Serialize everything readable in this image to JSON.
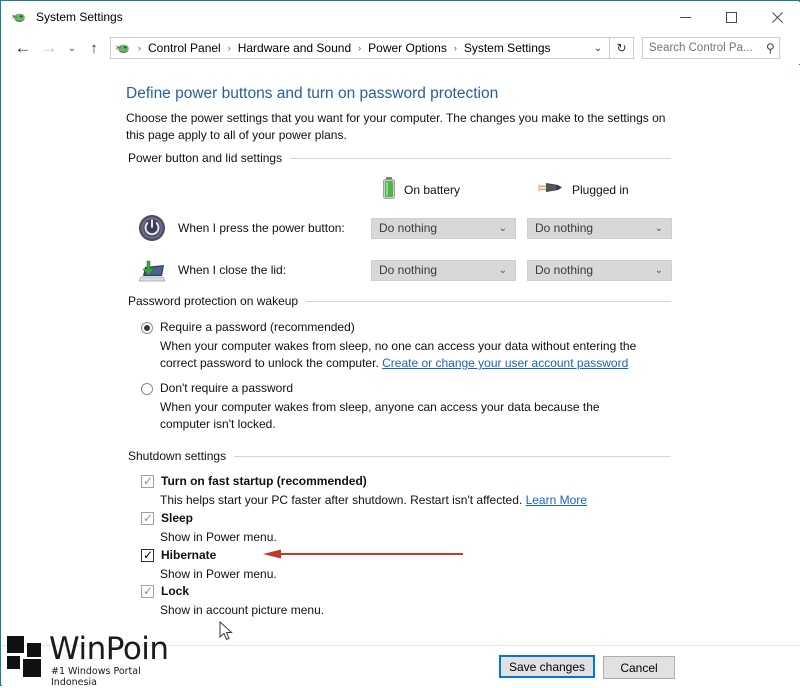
{
  "window": {
    "title": "System Settings",
    "icon": "power-options-icon",
    "controls": {
      "minimize": "minimize-icon",
      "maximize": "maximize-icon",
      "close": "close-icon"
    }
  },
  "nav": {
    "back": "back-arrow-icon",
    "forward": "forward-arrow-icon",
    "recent": "chevron-down-icon",
    "up": "up-arrow-icon",
    "breadcrumbs": [
      "Control Panel",
      "Hardware and Sound",
      "Power Options",
      "System Settings"
    ],
    "separator": "›",
    "address_dropdown": "chevron-down-icon",
    "refresh": "refresh-icon"
  },
  "search": {
    "value": "",
    "placeholder": "Search Control Pa...",
    "icon": "search-icon"
  },
  "page": {
    "title": "Define power buttons and turn on password protection",
    "description": "Choose the power settings that you want for your computer. The changes you make to the settings on this page apply to all of your power plans."
  },
  "power_lid": {
    "group_title": "Power button and lid settings",
    "columns": [
      {
        "label": "On battery",
        "icon": "battery-icon"
      },
      {
        "label": "Plugged in",
        "icon": "power-plug-icon"
      }
    ],
    "rows": [
      {
        "icon": "power-button-icon",
        "label": "When I press the power button:",
        "on_battery": "Do nothing",
        "plugged_in": "Do nothing"
      },
      {
        "icon": "laptop-lid-icon",
        "label": "When I close the lid:",
        "on_battery": "Do nothing",
        "plugged_in": "Do nothing"
      }
    ],
    "dropdown_caret": "chevron-down-icon"
  },
  "password_protection": {
    "group_title": "Password protection on wakeup",
    "options": [
      {
        "label": "Require a password (recommended)",
        "checked": true,
        "description": "When your computer wakes from sleep, no one can access your data without entering the correct password to unlock the computer.",
        "link": "Create or change your user account password"
      },
      {
        "label": "Don't require a password",
        "checked": false,
        "description": "When your computer wakes from sleep, anyone can access your data because the computer isn't locked.",
        "link": ""
      }
    ]
  },
  "shutdown_settings": {
    "group_title": "Shutdown settings",
    "items": [
      {
        "label": "Turn on fast startup (recommended)",
        "checked": true,
        "emphasized": false,
        "description": "This helps start your PC faster after shutdown. Restart isn't affected.",
        "link": "Learn More"
      },
      {
        "label": "Sleep",
        "checked": true,
        "emphasized": false,
        "description": "Show in Power menu.",
        "link": ""
      },
      {
        "label": "Hibernate",
        "checked": true,
        "emphasized": true,
        "description": "Show in Power menu.",
        "link": ""
      },
      {
        "label": "Lock",
        "checked": true,
        "emphasized": false,
        "description": "Show in account picture menu.",
        "link": ""
      }
    ]
  },
  "annotation": {
    "arrow_color": "#c0392b",
    "points_to": "Hibernate"
  },
  "footer": {
    "save_label": "Save changes",
    "cancel_label": "Cancel"
  },
  "watermark": {
    "name": "WinPoin",
    "tagline": "#1 Windows Portal Indonesia"
  },
  "colors": {
    "window_border": "#1c7d8e",
    "title_link": "#26619c",
    "hyperlink": "#1664c0",
    "focus_blue": "#0078d7",
    "annotation_red": "#c0392b"
  }
}
